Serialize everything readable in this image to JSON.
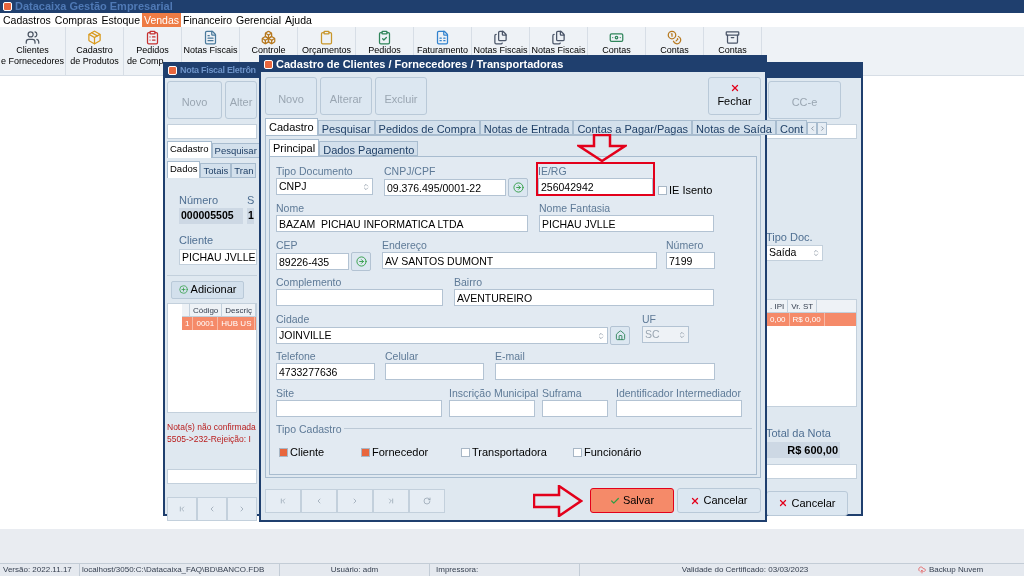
{
  "app_title": "Datacaixa Gestão Empresarial",
  "menu": [
    {
      "label": "Cadastros",
      "selected": false
    },
    {
      "label": "Compras",
      "selected": false
    },
    {
      "label": "Estoque",
      "selected": false
    },
    {
      "label": "Vendas",
      "selected": true
    },
    {
      "label": "Financeiro",
      "selected": false
    },
    {
      "label": "Gerencial",
      "selected": false
    },
    {
      "label": "Ajuda",
      "selected": false
    }
  ],
  "toolbar": [
    {
      "lines": [
        "Clientes",
        "e Fornecedores"
      ]
    },
    {
      "lines": [
        "Cadastro",
        "de Produtos"
      ]
    },
    {
      "lines": [
        "Pedidos",
        "de Comp"
      ]
    },
    {
      "lines": [
        "Notas Fiscais"
      ]
    },
    {
      "lines": [
        "Controle"
      ]
    },
    {
      "lines": [
        "Orçamentos"
      ]
    },
    {
      "lines": [
        "Pedidos"
      ]
    },
    {
      "lines": [
        "Faturamento"
      ]
    },
    {
      "lines": [
        "Notas Fiscais"
      ]
    },
    {
      "lines": [
        "Notas Fiscais"
      ]
    },
    {
      "lines": [
        "Contas"
      ]
    },
    {
      "lines": [
        "Contas"
      ]
    },
    {
      "lines": [
        "Contas"
      ]
    }
  ],
  "nfe_window": {
    "title": "Nota Fiscal Eletrôn",
    "buttons": [
      {
        "label": "Novo",
        "disabled": true
      },
      {
        "label": "Alter",
        "disabled": true
      }
    ],
    "cce_button": {
      "label": "CC-e",
      "disabled": true
    },
    "tabs": [
      {
        "label": "Cadastro",
        "selected": true
      },
      {
        "label": "Pesquisar",
        "selected": false
      }
    ],
    "subtabs": [
      {
        "label": "Dados",
        "selected": true
      },
      {
        "label": "Totais",
        "selected": false
      },
      {
        "label": "Tran",
        "selected": false
      }
    ],
    "numero": {
      "label": "Número",
      "value": "000005505"
    },
    "serie": {
      "label": "S",
      "value": "1"
    },
    "cliente": {
      "label": "Cliente",
      "value": "PICHAU JVLLE"
    },
    "add_button": "Adicionar",
    "items_table": {
      "columns": [
        "",
        "Código",
        "Descriç"
      ],
      "rows": [
        {
          "cells": [
            "1",
            "0001",
            "HUB US"
          ],
          "selected": true
        }
      ]
    },
    "tipo_doc": {
      "label": "Tipo Doc.",
      "value": "Saída"
    },
    "values_table": {
      "columns": [
        ". IPI",
        "Vr. ST"
      ],
      "rows": [
        {
          "cells": [
            "0,00",
            "R$ 0,00"
          ],
          "selected": true
        }
      ]
    },
    "messages": [
      "Nota(s) não confirmada",
      "5505->232-Rejeição: I"
    ],
    "total": {
      "label": "Total da Nota",
      "value": "R$ 600,00"
    },
    "cancel_button": "Cancelar"
  },
  "dialog": {
    "title": "Cadastro de Clientes / Fornecedores / Transportadoras",
    "buttons": [
      {
        "label": "Novo",
        "disabled": true
      },
      {
        "label": "Alterar",
        "disabled": true
      },
      {
        "label": "Excluir",
        "disabled": true
      }
    ],
    "close_button": "Fechar",
    "tabs": [
      {
        "label": "Cadastro",
        "selected": true
      },
      {
        "label": "Pesquisar",
        "selected": false
      },
      {
        "label": "Pedidos de Compra",
        "selected": false
      },
      {
        "label": "Notas de Entrada",
        "selected": false
      },
      {
        "label": "Contas a Pagar/Pagas",
        "selected": false
      },
      {
        "label": "Notas de Saída",
        "selected": false
      },
      {
        "label": "Cont",
        "selected": false
      }
    ],
    "subtabs": [
      {
        "label": "Principal",
        "selected": true
      },
      {
        "label": "Dados Pagamento",
        "selected": false
      }
    ],
    "form_rows": [
      [
        {
          "kind": "select",
          "label": "Tipo Documento",
          "value": "CNPJ"
        },
        {
          "kind": "text_button",
          "label": "CNPJ/CPF",
          "value": "09.376.495/0001-22"
        },
        {
          "kind": "text",
          "label": "IE/RG",
          "value": "256042942",
          "highlighted": true
        },
        {
          "kind": "checkbox",
          "label": "IE Isento",
          "checked": false
        }
      ],
      [
        {
          "kind": "text",
          "label": "Nome",
          "value": "BAZAM  PICHAU INFORMATICA LTDA"
        },
        {
          "kind": "text",
          "label": "Nome Fantasia",
          "value": "PICHAU JVLLE"
        }
      ],
      [
        {
          "kind": "text_button",
          "label": "CEP",
          "value": "89226-435"
        },
        {
          "kind": "text",
          "label": "Endereço",
          "value": "AV SANTOS DUMONT"
        },
        {
          "kind": "text",
          "label": "Número",
          "value": "7199"
        }
      ],
      [
        {
          "kind": "text",
          "label": "Complemento"
        },
        {
          "kind": "text",
          "label": "Bairro",
          "value": "AVENTUREIRO"
        }
      ],
      [
        {
          "kind": "select_button",
          "label": "Cidade",
          "value": "JOINVILLE"
        },
        {
          "kind": "select",
          "label": "UF",
          "value": "SC",
          "disabled": true
        }
      ],
      [
        {
          "kind": "text",
          "label": "Telefone",
          "value": "4733277636"
        },
        {
          "kind": "text",
          "label": "Celular"
        },
        {
          "kind": "text",
          "label": "E-mail"
        }
      ],
      [
        {
          "kind": "text",
          "label": "Site"
        },
        {
          "kind": "text",
          "label": "Inscrição Municipal"
        },
        {
          "kind": "text",
          "label": "Suframa"
        },
        {
          "kind": "text",
          "label": "Identificador Intermediador"
        }
      ]
    ],
    "tipo_cadastro": {
      "label": "Tipo Cadastro",
      "options": [
        {
          "label": "Cliente",
          "checked": true
        },
        {
          "label": "Fornecedor",
          "checked": true
        },
        {
          "label": "Transportadora",
          "checked": false
        },
        {
          "label": "Funcionário",
          "checked": false
        }
      ]
    },
    "save_button": {
      "label": "Salvar",
      "highlighted": true
    },
    "cancel_button": "Cancelar"
  },
  "status_bar": {
    "version": "Versão: 2022.11.17",
    "database": "localhost/3050:C:\\Datacaixa_FAQ\\BD\\BANCO.FDB",
    "user": "Usuário: adm",
    "printer": "Impressora:",
    "certificate": "Validade do Certificado: 03/03/2023",
    "backup": "Backup Nuvem"
  }
}
